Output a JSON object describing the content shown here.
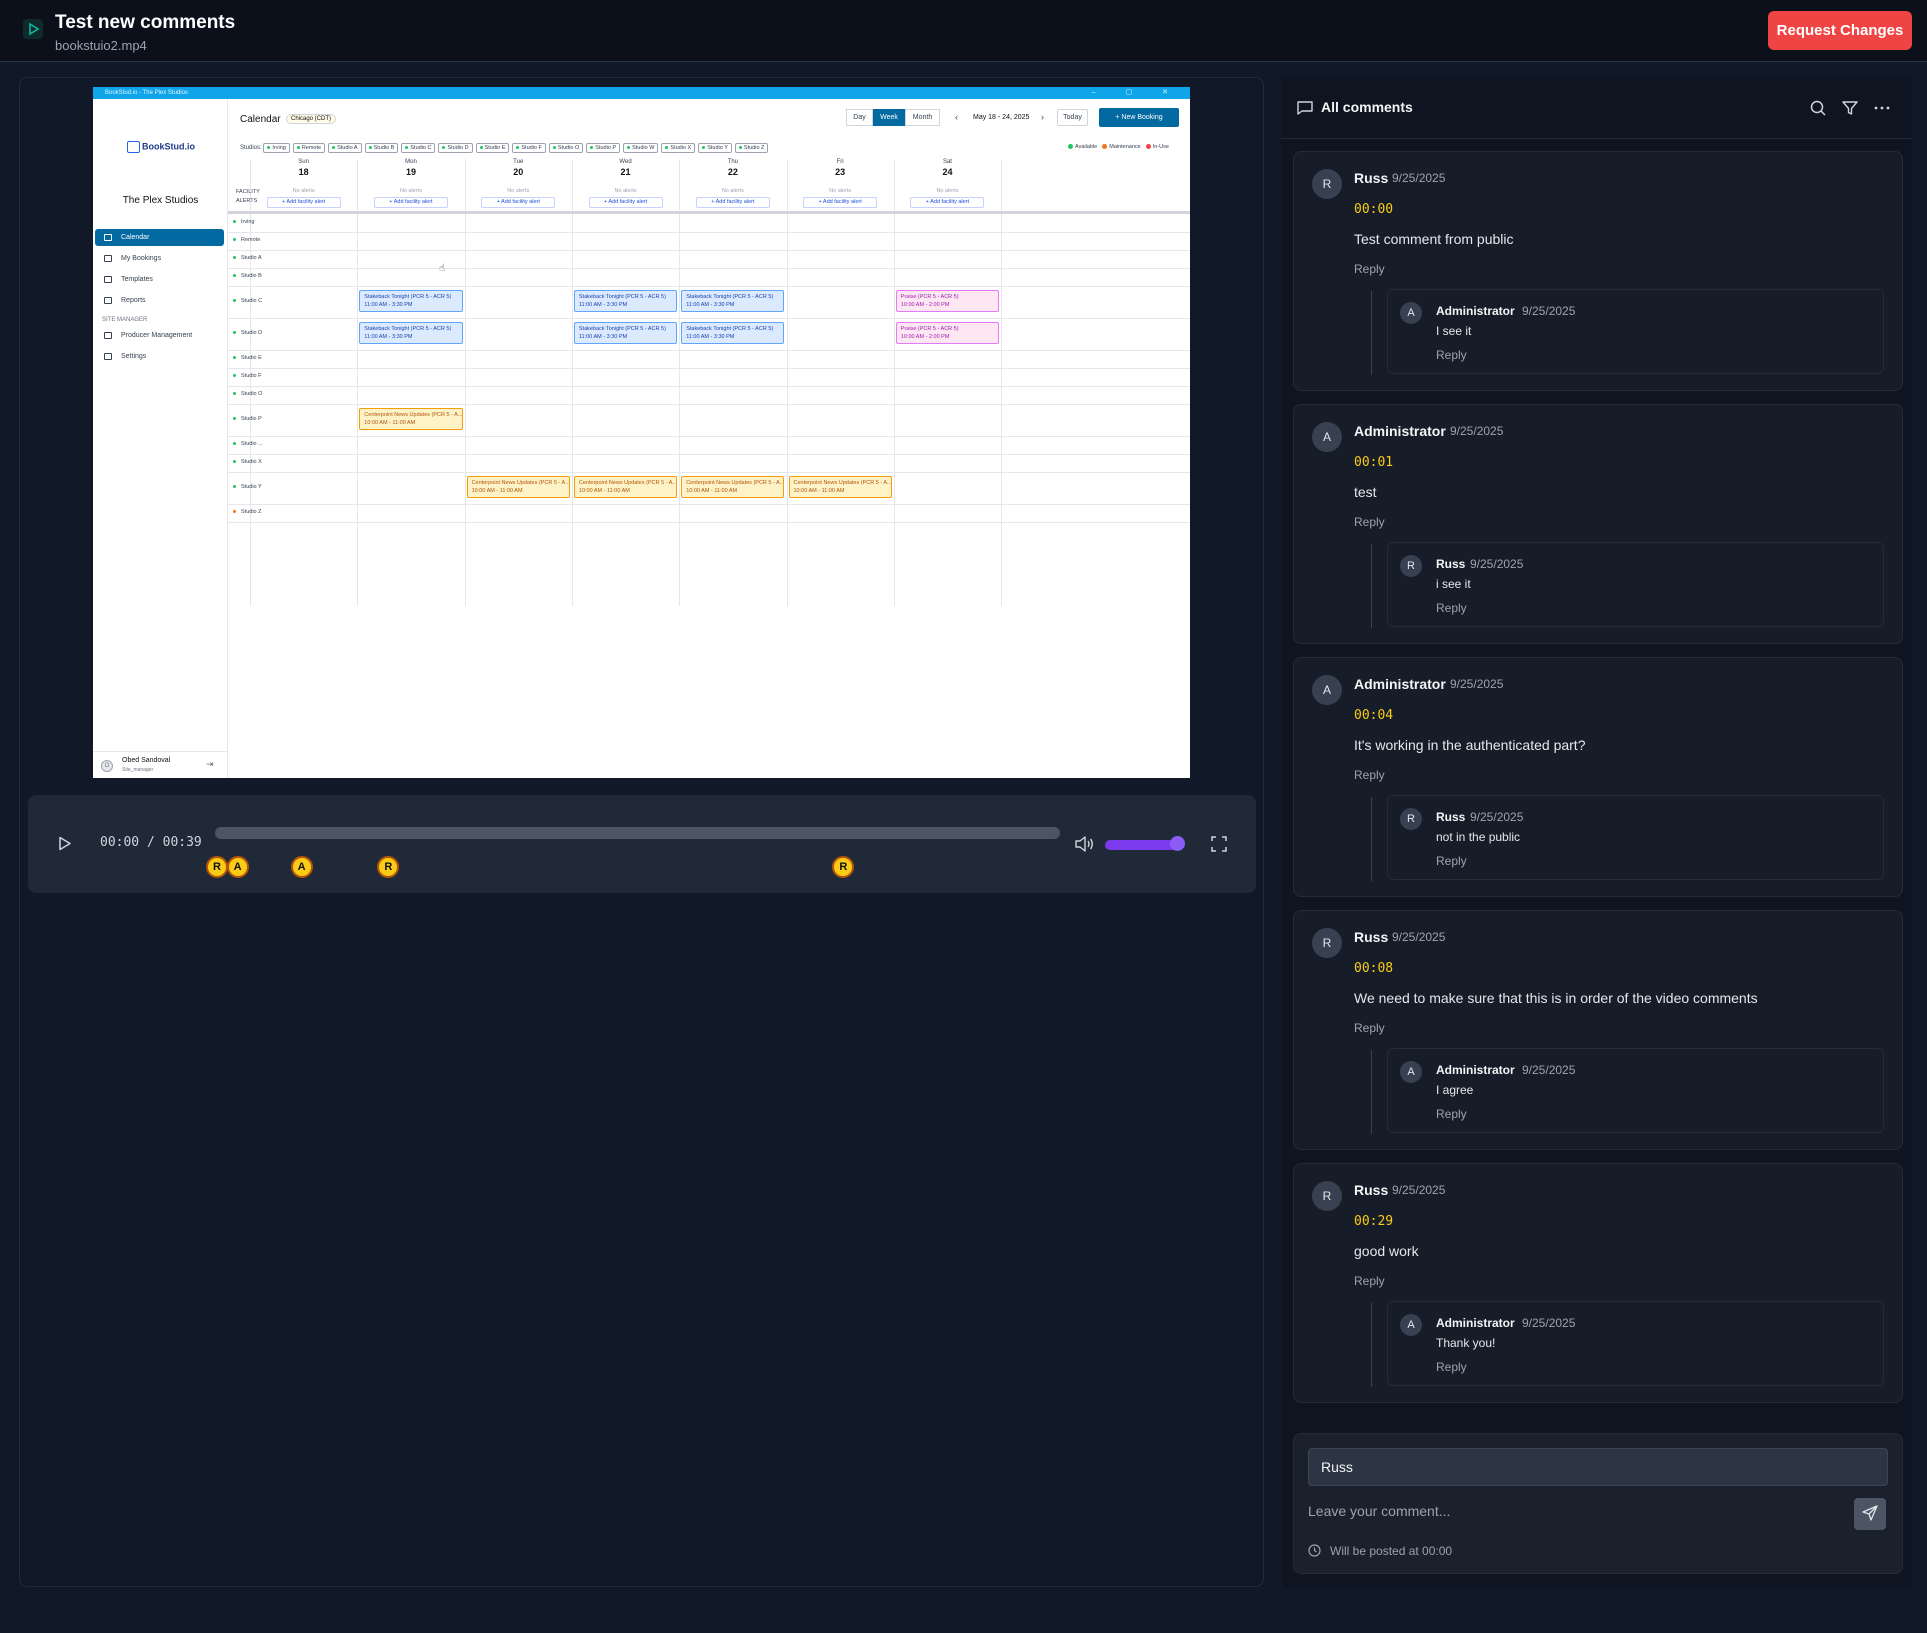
{
  "header": {
    "title": "Test new comments",
    "filename": "bookstuio2.mp4",
    "request_changes": "Request Changes"
  },
  "video": {
    "app": {
      "window_title": "BookStud.io - The Plex Studios",
      "logo": "BookStud.io",
      "studio_name": "The Plex Studios",
      "nav": [
        "Calendar",
        "My Bookings",
        "Templates",
        "Reports"
      ],
      "site_manager_label": "SITE MANAGER",
      "manager_nav": [
        "Producer Management",
        "Settings"
      ],
      "user_initial": "O",
      "user_name": "Obed Sandoval",
      "user_role": "Site_manager",
      "calendar_title": "Calendar",
      "timezone": "Chicago (CDT)",
      "views": [
        "Day",
        "Week",
        "Month"
      ],
      "active_view": "Week",
      "range": "May 18 - 24, 2025",
      "prev_glyph": "‹",
      "next_glyph": "›",
      "today": "Today",
      "new_booking": "+ New Booking",
      "studios_label": "Studios:",
      "studio_chips": [
        "Irving",
        "Remote",
        "Studio A",
        "Studio B",
        "Studio C",
        "Studio D",
        "Studio E",
        "Studio F",
        "Studio O",
        "Studio P",
        "Studio W",
        "Studio X",
        "Studio Y",
        "Studio Z"
      ],
      "legend": [
        {
          "label": "Available",
          "color": "#22c55e"
        },
        {
          "label": "Maintenance",
          "color": "#f97316"
        },
        {
          "label": "In-Use",
          "color": "#ef4444"
        }
      ],
      "days": [
        {
          "dow": "Sun",
          "date": "18"
        },
        {
          "dow": "Mon",
          "date": "19"
        },
        {
          "dow": "Tue",
          "date": "20"
        },
        {
          "dow": "Wed",
          "date": "21"
        },
        {
          "dow": "Thu",
          "date": "22"
        },
        {
          "dow": "Fri",
          "date": "23"
        },
        {
          "dow": "Sat",
          "date": "24"
        }
      ],
      "facility_label": "FACILITY",
      "alerts_label": "ALERTS",
      "no_alerts": "No alerts",
      "add_alert": "+ Add facility alert",
      "rows": [
        "Irving",
        "Remote",
        "Studio A",
        "Studio B",
        "Studio C",
        "Studio D",
        "Studio E",
        "Studio F",
        "Studio O",
        "Studio P",
        "Studio ...",
        "Studio X",
        "Studio Y",
        "Studio Z"
      ],
      "events": [
        {
          "row": "Studio C",
          "day": 1,
          "title": "Stakeback Tonight (PCR 5 - ACR 5)",
          "time": "11:00 AM - 3:30 PM",
          "kind": "blue"
        },
        {
          "row": "Studio C",
          "day": 3,
          "title": "Stakeback Tonight (PCR 5 - ACR 5)",
          "time": "11:00 AM - 3:30 PM",
          "kind": "blue"
        },
        {
          "row": "Studio C",
          "day": 4,
          "title": "Stakeback Tonight (PCR 5 - ACR 5)",
          "time": "11:00 AM - 3:30 PM",
          "kind": "blue"
        },
        {
          "row": "Studio C",
          "day": 6,
          "title": "Praise (PCR 5 - ACR 5)",
          "time": "10:00 AM - 2:00 PM",
          "kind": "pink"
        },
        {
          "row": "Studio D",
          "day": 1,
          "title": "Stakeback Tonight (PCR 5 - ACR 5)",
          "time": "11:00 AM - 3:30 PM",
          "kind": "blue"
        },
        {
          "row": "Studio D",
          "day": 3,
          "title": "Stakeback Tonight (PCR 5 - ACR 5)",
          "time": "11:00 AM - 3:30 PM",
          "kind": "blue"
        },
        {
          "row": "Studio D",
          "day": 4,
          "title": "Stakeback Tonight (PCR 5 - ACR 5)",
          "time": "11:00 AM - 3:30 PM",
          "kind": "blue"
        },
        {
          "row": "Studio D",
          "day": 6,
          "title": "Praise (PCR 5 - ACR 5)",
          "time": "10:00 AM - 2:00 PM",
          "kind": "pink"
        },
        {
          "row": "Studio P",
          "day": 1,
          "title": "Centerpoint News Updates (PCR 5 - A...",
          "time": "10:00 AM - 11:00 AM",
          "kind": "orange"
        },
        {
          "row": "Studio Y",
          "day": 2,
          "title": "Centerpoint News Updates (PCR 5 - A...",
          "time": "10:00 AM - 11:00 AM",
          "kind": "orange"
        },
        {
          "row": "Studio Y",
          "day": 3,
          "title": "Centerpoint News Updates (PCR 5 - A...",
          "time": "10:00 AM - 11:00 AM",
          "kind": "orange"
        },
        {
          "row": "Studio Y",
          "day": 4,
          "title": "Centerpoint News Updates (PCR 5 - A...",
          "time": "10:00 AM - 11:00 AM",
          "kind": "orange"
        },
        {
          "row": "Studio Y",
          "day": 5,
          "title": "Centerpoint News Updates (PCR 5 - A...",
          "time": "10:00 AM - 11:00 AM",
          "kind": "orange"
        }
      ]
    }
  },
  "player": {
    "time": "00:00 / 00:39",
    "duration_seconds": 39,
    "progress": 0,
    "volume": 1.0,
    "markers": [
      {
        "initial": "R",
        "seconds": 0
      },
      {
        "initial": "A",
        "seconds": 1
      },
      {
        "initial": "A",
        "seconds": 4
      },
      {
        "initial": "R",
        "seconds": 8
      },
      {
        "initial": "R",
        "seconds": 29
      }
    ]
  },
  "comments_panel": {
    "title": "All comments",
    "comments": [
      {
        "initial": "R",
        "author": "Russ",
        "date": "9/25/2025",
        "timestamp": "00:00",
        "text": "Test comment from public",
        "reply_label": "Reply",
        "reply": {
          "initial": "A",
          "author": "Administrator",
          "date": "9/25/2025",
          "text": "I see it",
          "reply_label": "Reply"
        }
      },
      {
        "initial": "A",
        "author": "Administrator",
        "date": "9/25/2025",
        "timestamp": "00:01",
        "text": "test",
        "reply_label": "Reply",
        "reply": {
          "initial": "R",
          "author": "Russ",
          "date": "9/25/2025",
          "text": "i see it",
          "reply_label": "Reply"
        }
      },
      {
        "initial": "A",
        "author": "Administrator",
        "date": "9/25/2025",
        "timestamp": "00:04",
        "text": "It's working in the authenticated part?",
        "reply_label": "Reply",
        "reply": {
          "initial": "R",
          "author": "Russ",
          "date": "9/25/2025",
          "text": "not in the public",
          "reply_label": "Reply"
        }
      },
      {
        "initial": "R",
        "author": "Russ",
        "date": "9/25/2025",
        "timestamp": "00:08",
        "text": "We need to make sure that this is in order of the video comments",
        "reply_label": "Reply",
        "reply": {
          "initial": "A",
          "author": "Administrator",
          "date": "9/25/2025",
          "text": "I agree",
          "reply_label": "Reply"
        }
      },
      {
        "initial": "R",
        "author": "Russ",
        "date": "9/25/2025",
        "timestamp": "00:29",
        "text": "good work",
        "reply_label": "Reply",
        "reply": {
          "initial": "A",
          "author": "Administrator",
          "date": "9/25/2025",
          "text": "Thank you!",
          "reply_label": "Reply"
        }
      }
    ]
  },
  "composer": {
    "name_value": "Russ",
    "placeholder": "Leave your comment...",
    "post_note": "Will be posted at 00:00"
  },
  "colors": {
    "accent_red": "#ef4444",
    "timestamp_yellow": "#facc15",
    "volume_purple": "#8b5cf6",
    "app_blue": "#0369a1"
  },
  "icons": [
    "play-icon",
    "volume-icon",
    "fullscreen-icon",
    "comment-icon",
    "search-icon",
    "filter-icon",
    "more-icon",
    "send-icon",
    "clock-icon"
  ]
}
